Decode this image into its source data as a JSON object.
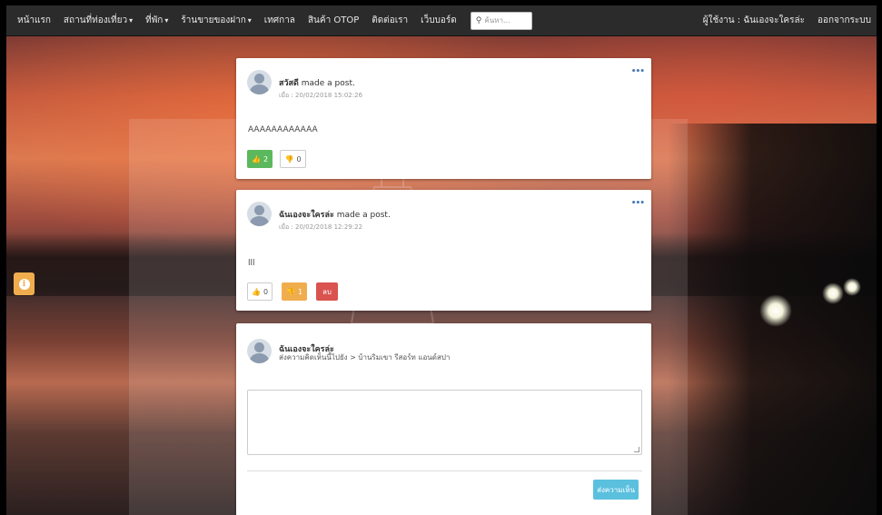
{
  "navbar": {
    "items": [
      {
        "label": "หน้าแรก",
        "dropdown": false
      },
      {
        "label": "สถานที่ท่องเที่ยว",
        "dropdown": true
      },
      {
        "label": "ที่พัก",
        "dropdown": true
      },
      {
        "label": "ร้านขายของฝาก",
        "dropdown": true
      },
      {
        "label": "เทศกาล",
        "dropdown": false
      },
      {
        "label": "สินค้า OTOP",
        "dropdown": false
      },
      {
        "label": "ติดต่อเรา",
        "dropdown": false
      },
      {
        "label": "เว็บบอร์ด",
        "dropdown": false
      }
    ],
    "search_placeholder": "ค้นหา...",
    "user_label": "ผู้ใช้งาน : ฉันเองจะใครล่ะ",
    "logout_label": "ออกจากระบบ"
  },
  "posts": [
    {
      "author": "สวัสดี",
      "action": "made a post.",
      "timestamp": "เมื่อ : 20/02/2018 15:02:26",
      "text": "AAAAAAAAAAAA",
      "likes": "2",
      "dislikes": "0"
    },
    {
      "author": "ฉันเองจะใครล่ะ",
      "action": "made a post.",
      "timestamp": "เมื่อ : 20/02/2018 12:29:22",
      "text": "lll",
      "likes": "0",
      "dislikes": "1",
      "delete_label": "ลบ"
    }
  ],
  "comment_box": {
    "name": "ฉันเองจะใครล่ะ",
    "location": "ส่งความคิดเห็นนี้ไปยัง > บ้านริมเขา รีสอร์ท แอนด์สปา",
    "submit_label": "ส่งความเห็น"
  },
  "colors": {
    "navbar_bg": "#2b2b2b",
    "like_active": "#5cb85c",
    "warning": "#f0ad4e",
    "danger": "#d9534f",
    "info": "#5bc0de",
    "link": "#4a7bb7"
  },
  "icons": {
    "info": "info-circle-icon",
    "like": "thumbs-up-icon",
    "dislike": "thumbs-down-icon",
    "search": "search-icon",
    "more": "ellipsis-icon"
  }
}
